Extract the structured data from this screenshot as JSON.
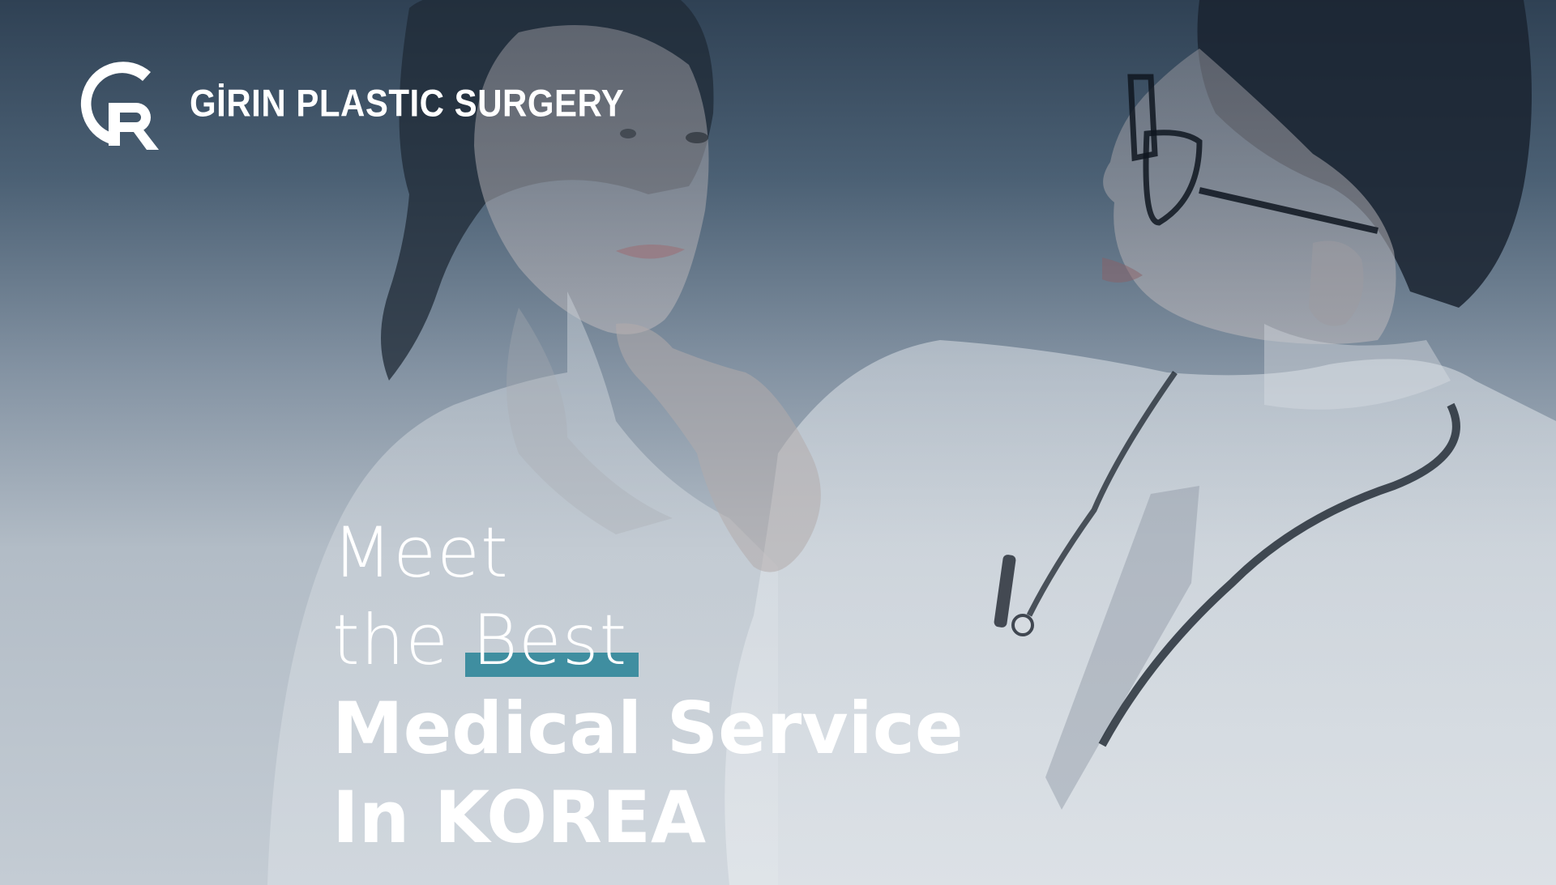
{
  "brand": {
    "name": "GİRIN PLASTIC SURGERY",
    "logo_icon": "gr-monogram-icon",
    "logo_letters": "GR"
  },
  "hero": {
    "line1": "Meet",
    "line2_prefix": "the ",
    "line2_highlight": "Best",
    "line3": "Medical Service",
    "line4": "In KOREA"
  },
  "colors": {
    "accent": "#3f8ea0",
    "text": "#ffffff",
    "background_top": "#2f4154",
    "background_bottom": "#c4ccd4"
  }
}
